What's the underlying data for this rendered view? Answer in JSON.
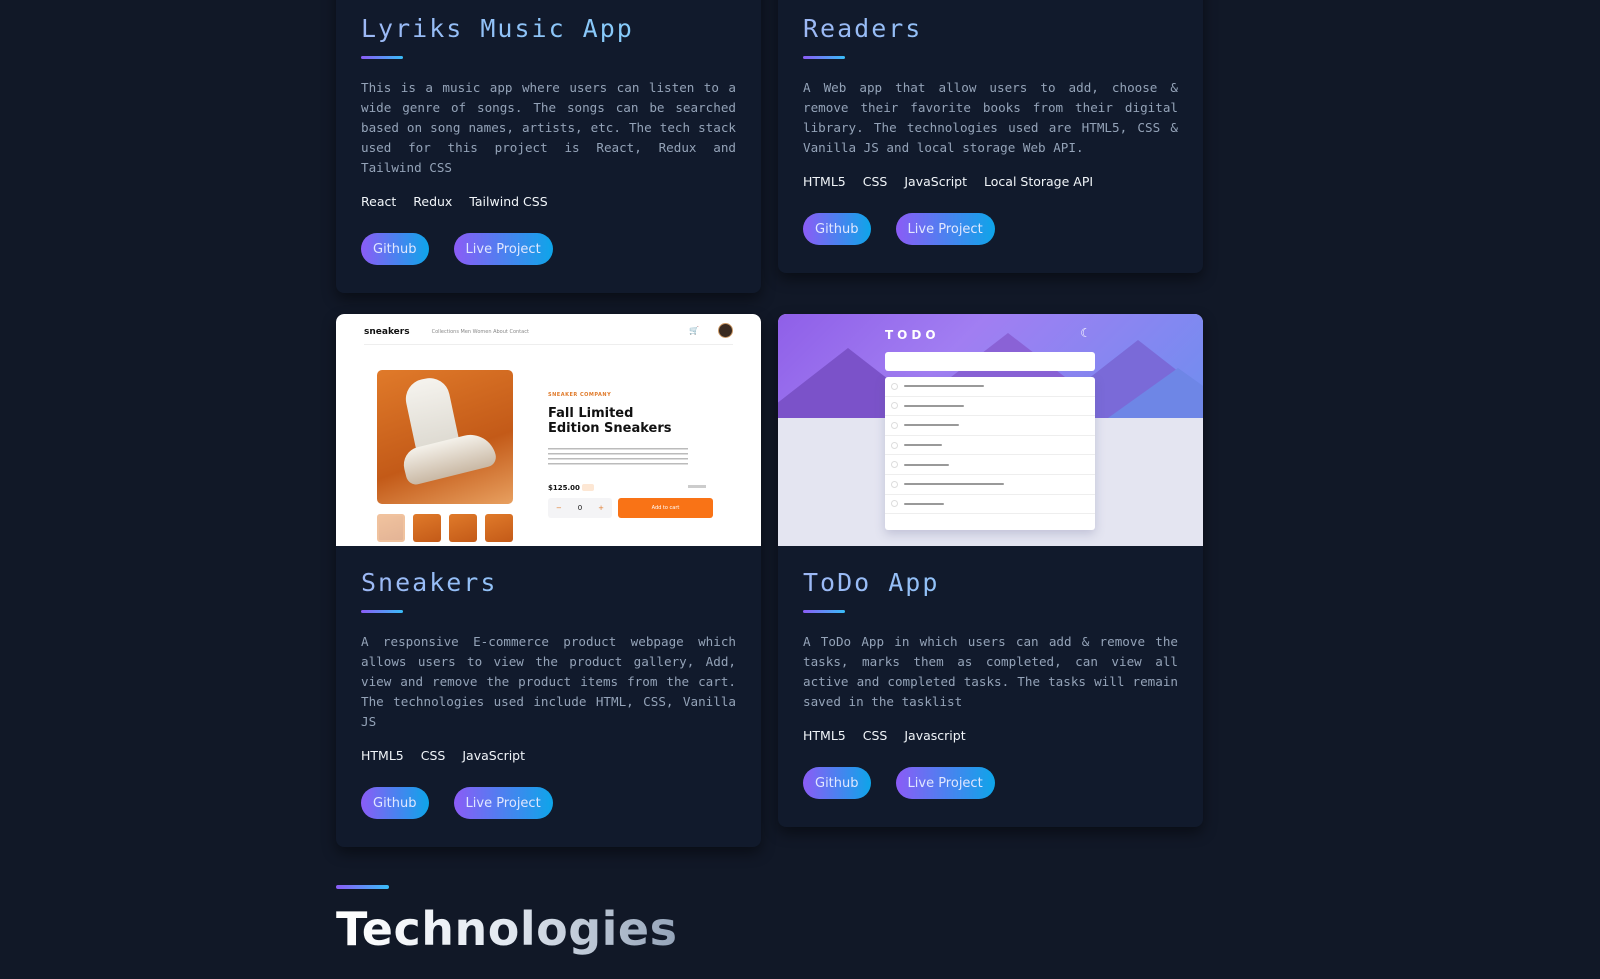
{
  "projects": [
    {
      "title": "Lyriks Music App",
      "description": "This is a music app where users can listen to a wide genre of songs. The songs can be searched based on song names, artists, etc. The tech stack used for this project is React, Redux and Tailwind CSS",
      "tags": [
        "React",
        "Redux",
        "Tailwind CSS"
      ],
      "github_label": "Github",
      "live_label": "Live Project"
    },
    {
      "title": "Readers",
      "description": "A Web app that allow users to add, choose & remove their favorite books from their digital library. The technologies used are HTML5, CSS & Vanilla JS and local storage Web API.",
      "tags": [
        "HTML5",
        "CSS",
        "JavaScript",
        "Local Storage API"
      ],
      "github_label": "Github",
      "live_label": "Live Project"
    },
    {
      "title": "Sneakers",
      "description": "A responsive E-commerce product webpage which allows users to view the product gallery, Add, view and remove the product items from the cart. The technologies used include HTML, CSS, Vanilla JS",
      "tags": [
        "HTML5",
        "CSS",
        "JavaScript"
      ],
      "github_label": "Github",
      "live_label": "Live Project",
      "preview": {
        "logo": "sneakers",
        "nav": "Collections  Men  Women  About  Contact",
        "company": "SNEAKER COMPANY",
        "heading": "Fall Limited Edition Sneakers",
        "price": "$125.00",
        "qty": "0",
        "add_to_cart": "Add to cart"
      }
    },
    {
      "title": "ToDo App",
      "description": "A ToDo App in which users can add & remove the tasks, marks them as completed, can view all active and completed tasks. The tasks will remain saved in the tasklist",
      "tags": [
        "HTML5",
        "CSS",
        "Javascript"
      ],
      "github_label": "Github",
      "live_label": "Live Project",
      "preview": {
        "title": "TODO"
      }
    }
  ],
  "technologies": {
    "title": "Technologies"
  },
  "colors": {
    "background": "#111827",
    "card": "#111a2c",
    "accent_start": "#8b5cf6",
    "accent_end": "#0ea5e9"
  }
}
